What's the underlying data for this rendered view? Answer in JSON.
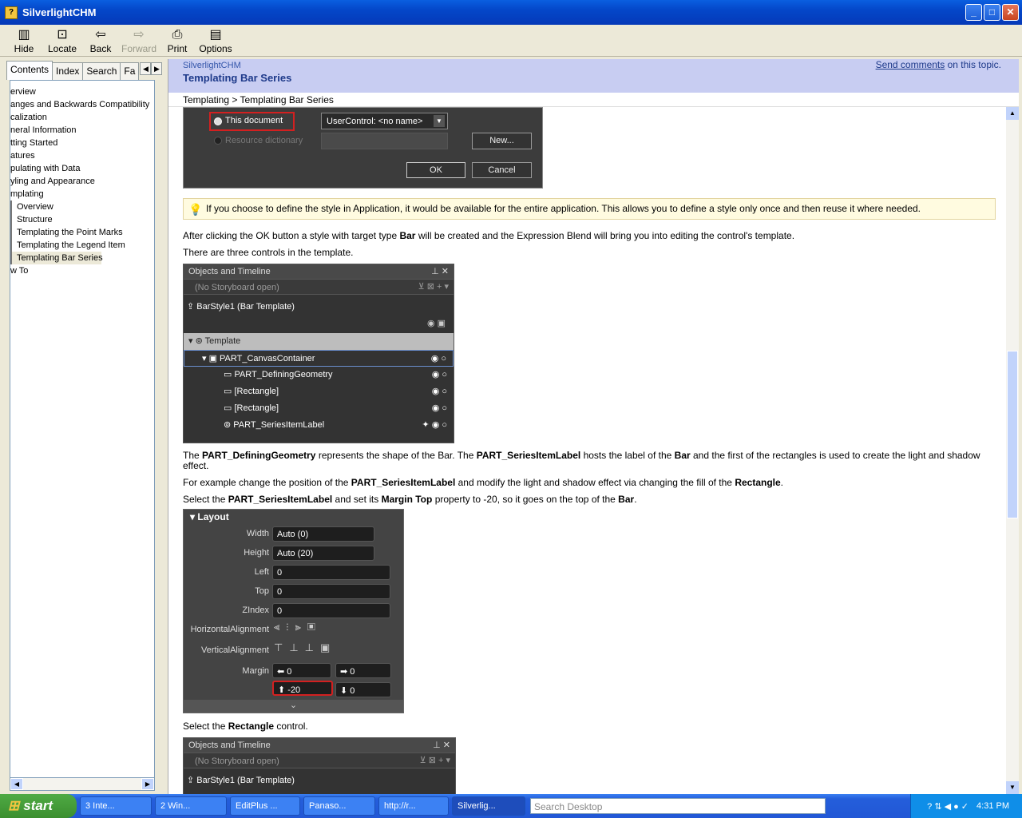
{
  "window": {
    "title": "SilverlightCHM"
  },
  "toolbar": [
    {
      "label": "Hide",
      "icon": "hide-icon",
      "glyph": "▥"
    },
    {
      "label": "Locate",
      "icon": "locate-icon",
      "glyph": "⊡"
    },
    {
      "label": "Back",
      "icon": "back-arrow-icon",
      "glyph": "⇦"
    },
    {
      "label": "Forward",
      "icon": "forward-arrow-icon",
      "glyph": "⇨"
    },
    {
      "label": "Print",
      "icon": "print-icon",
      "glyph": "⎙"
    },
    {
      "label": "Options",
      "icon": "options-icon",
      "glyph": "▤"
    }
  ],
  "nav_tabs": [
    "Contents",
    "Index",
    "Search",
    "Fa"
  ],
  "tree": [
    "erview",
    "anges and Backwards Compatibility",
    "calization",
    "neral Information",
    "tting Started",
    "atures",
    "pulating with Data",
    "yling and Appearance",
    "mplating",
    "Overview",
    "Structure",
    "Templating the Point Marks",
    "Templating the Legend Item",
    "Templating Bar Series",
    "w To"
  ],
  "header": {
    "subtitle": "SilverlightCHM",
    "title": "Templating Bar Series",
    "send_link": "Send comments",
    "send_suffix": " on this topic.",
    "breadcrumb": "Templating > Templating Bar Series"
  },
  "dialog": {
    "option1": "This document",
    "option2": "Resource dictionary",
    "select": "UserControl: <no name>",
    "new": "New...",
    "ok": "OK",
    "cancel": "Cancel"
  },
  "tip": "If you choose to define the style in Application, it would be available for the entire application. This allows you to define a style only once and then reuse it where needed.",
  "para1": {
    "a": "After clicking the OK button a style with target type ",
    "b": "Bar",
    "c": " will be created and the Expression Blend will bring you into editing the control's template."
  },
  "para2": "There are three controls in the template.",
  "objects": {
    "header": "Objects and Timeline",
    "storyboard": "(No Storyboard open)",
    "root": "BarStyle1 (Bar Template)",
    "template": "Template",
    "items": [
      "PART_CanvasContainer",
      "PART_DefiningGeometry",
      "[Rectangle]",
      "[Rectangle]",
      "PART_SeriesItemLabel"
    ]
  },
  "para3": {
    "a": "The ",
    "b": "PART_DefiningGeometry",
    "c": " represents the shape of the Bar. The ",
    "d": "PART_SeriesItemLabel",
    "e": " hosts the label of the ",
    "f": "Bar",
    "g": " and the first of the rectangles is used to create the light and shadow effect."
  },
  "para4": {
    "a": "For example change the position of the ",
    "b": "PART_SeriesItemLabel",
    "c": " and modify the light and shadow effect via changing the fill of the ",
    "d": "Rectangle",
    "e": "."
  },
  "para5": {
    "a": "Select the ",
    "b": "PART_SeriesItemLabel",
    "c": " and set its ",
    "d": "Margin Top",
    "e": " property to -20, so it goes on the top of the ",
    "f": "Bar",
    "g": "."
  },
  "layout": {
    "title": "Layout",
    "rows": [
      {
        "label": "Width",
        "value": "Auto (0)"
      },
      {
        "label": "Height",
        "value": "Auto (20)"
      },
      {
        "label": "Left",
        "value": "0"
      },
      {
        "label": "Top",
        "value": "0"
      },
      {
        "label": "ZIndex",
        "value": "0"
      }
    ],
    "halign": "HorizontalAlignment",
    "valign": "VerticalAlignment",
    "margin": "Margin",
    "m_left": "0",
    "m_right": "0",
    "m_top": "-20",
    "m_bottom": "0"
  },
  "para6": {
    "a": "Select the ",
    "b": "Rectangle",
    "c": " control."
  },
  "objects2": {
    "header": "Objects and Timeline",
    "storyboard": "(No Storyboard open)",
    "root": "BarStyle1 (Bar Template)"
  },
  "taskbar": {
    "start": "start",
    "items": [
      "3 Inte...",
      "2 Win...",
      "EditPlus ...",
      "Panaso...",
      "http://r...",
      "Silverlig..."
    ],
    "search": "Search Desktop",
    "clock": "4:31 PM"
  }
}
